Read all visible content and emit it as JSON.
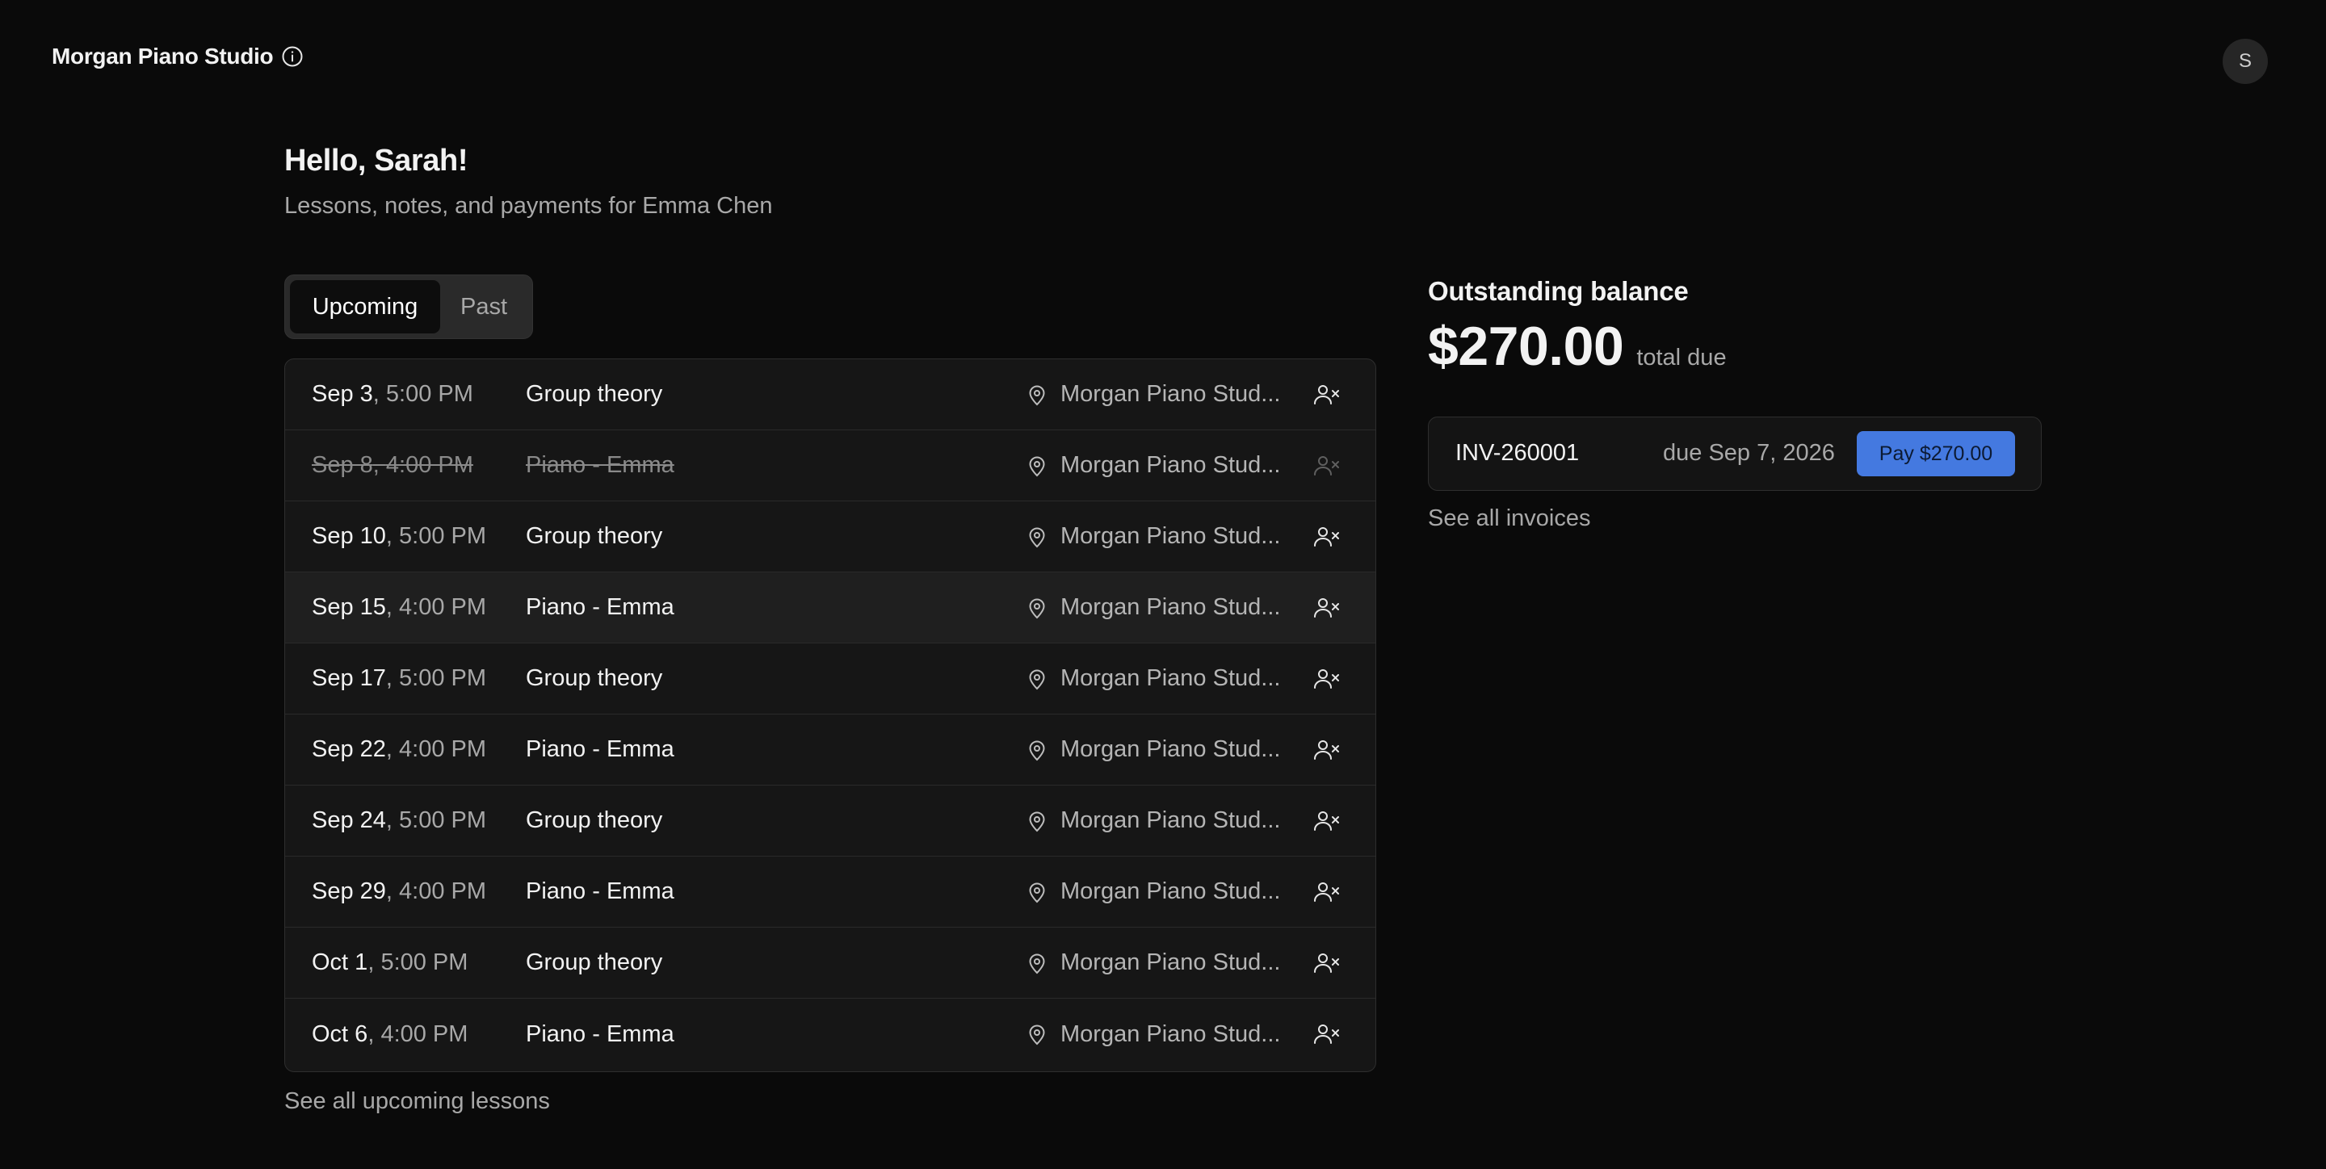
{
  "header": {
    "studio_name": "Morgan Piano Studio",
    "avatar_initial": "S"
  },
  "greeting": {
    "title": "Hello, Sarah!",
    "subtitle": "Lessons, notes, and payments for Emma Chen"
  },
  "tabs": [
    {
      "label": "Upcoming",
      "active": true
    },
    {
      "label": "Past",
      "active": false
    }
  ],
  "lessons": [
    {
      "date": "Sep 3",
      "time": "5:00 PM",
      "title": "Group theory",
      "location": "Morgan Piano Stud...",
      "cancelled": false
    },
    {
      "date": "Sep 8",
      "time": "4:00 PM",
      "title": "Piano - Emma",
      "location": "Morgan Piano Stud...",
      "cancelled": true
    },
    {
      "date": "Sep 10",
      "time": "5:00 PM",
      "title": "Group theory",
      "location": "Morgan Piano Stud...",
      "cancelled": false
    },
    {
      "date": "Sep 15",
      "time": "4:00 PM",
      "title": "Piano - Emma",
      "location": "Morgan Piano Stud...",
      "cancelled": false
    },
    {
      "date": "Sep 17",
      "time": "5:00 PM",
      "title": "Group theory",
      "location": "Morgan Piano Stud...",
      "cancelled": false
    },
    {
      "date": "Sep 22",
      "time": "4:00 PM",
      "title": "Piano - Emma",
      "location": "Morgan Piano Stud...",
      "cancelled": false
    },
    {
      "date": "Sep 24",
      "time": "5:00 PM",
      "title": "Group theory",
      "location": "Morgan Piano Stud...",
      "cancelled": false
    },
    {
      "date": "Sep 29",
      "time": "4:00 PM",
      "title": "Piano - Emma",
      "location": "Morgan Piano Stud...",
      "cancelled": false
    },
    {
      "date": "Oct 1",
      "time": "5:00 PM",
      "title": "Group theory",
      "location": "Morgan Piano Stud...",
      "cancelled": false
    },
    {
      "date": "Oct 6",
      "time": "4:00 PM",
      "title": "Piano - Emma",
      "location": "Morgan Piano Stud...",
      "cancelled": false
    }
  ],
  "see_all_lessons": "See all upcoming lessons",
  "balance": {
    "heading": "Outstanding balance",
    "amount": "$270.00",
    "amount_suffix": "total due"
  },
  "invoice": {
    "id": "INV-260001",
    "due": "due Sep 7, 2026",
    "pay_label": "Pay $270.00"
  },
  "see_all_invoices": "See all invoices",
  "colors": {
    "background": "#0a0a0a",
    "accent": "#4479e0"
  }
}
